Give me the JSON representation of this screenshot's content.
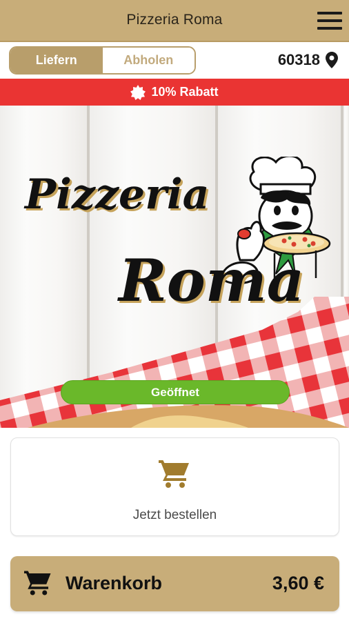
{
  "header": {
    "title": "Pizzeria Roma",
    "menu_icon": "hamburger-menu-icon"
  },
  "mode_toggle": {
    "delivery_label": "Liefern",
    "pickup_label": "Abholen",
    "selected": "Liefern"
  },
  "location": {
    "zip_code": "60318",
    "icon": "location-pin-icon"
  },
  "promo": {
    "text": "10% Rabatt",
    "icon": "discount-badge-icon"
  },
  "hero": {
    "logo_line1": "Pizzeria",
    "logo_line2": "Roma",
    "status": "Geöffnet",
    "colors": {
      "status": "#6ab82a",
      "tablecloth": "#e8343a"
    }
  },
  "order_card": {
    "label": "Jetzt bestellen",
    "icon": "shopping-cart-icon"
  },
  "cart": {
    "label": "Warenkorb",
    "total": "3,60 €",
    "icon": "shopping-cart-icon"
  },
  "colors": {
    "brand_gold": "#c8ad79",
    "accent_gold": "#b89e6b",
    "promo_red": "#ea3433"
  }
}
